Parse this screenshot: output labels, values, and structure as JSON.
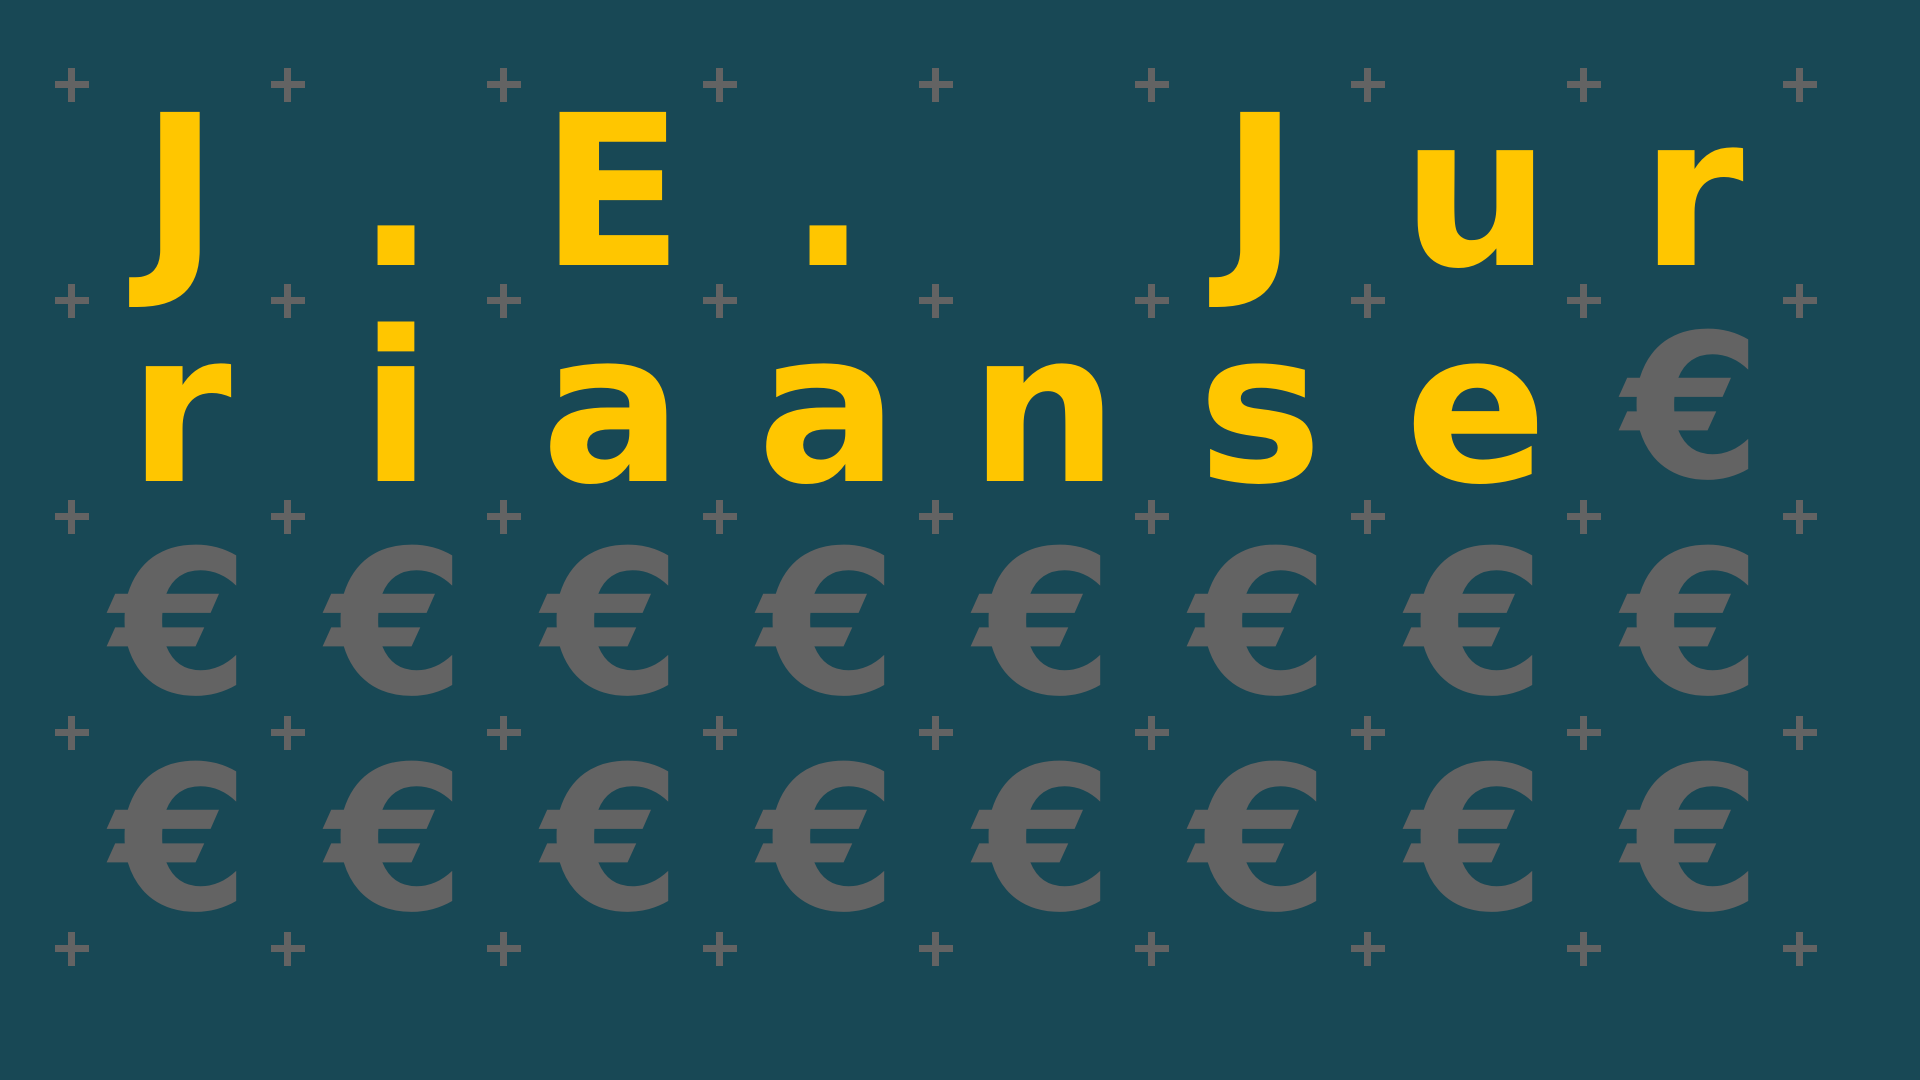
{
  "letters": [
    "J",
    ".",
    "E",
    ".",
    "",
    "J",
    "u",
    "r",
    "r",
    "i",
    "a",
    "a",
    "n",
    "s",
    "e",
    "€",
    "€",
    "€",
    "€",
    "€",
    "€",
    "€",
    "€",
    "€",
    "€",
    "€",
    "€",
    "€",
    "€",
    "€",
    "€",
    "€"
  ],
  "colors": {
    "background": "#184855",
    "letter": "#ffc600",
    "euro": "#636363",
    "plus": "#636363"
  }
}
